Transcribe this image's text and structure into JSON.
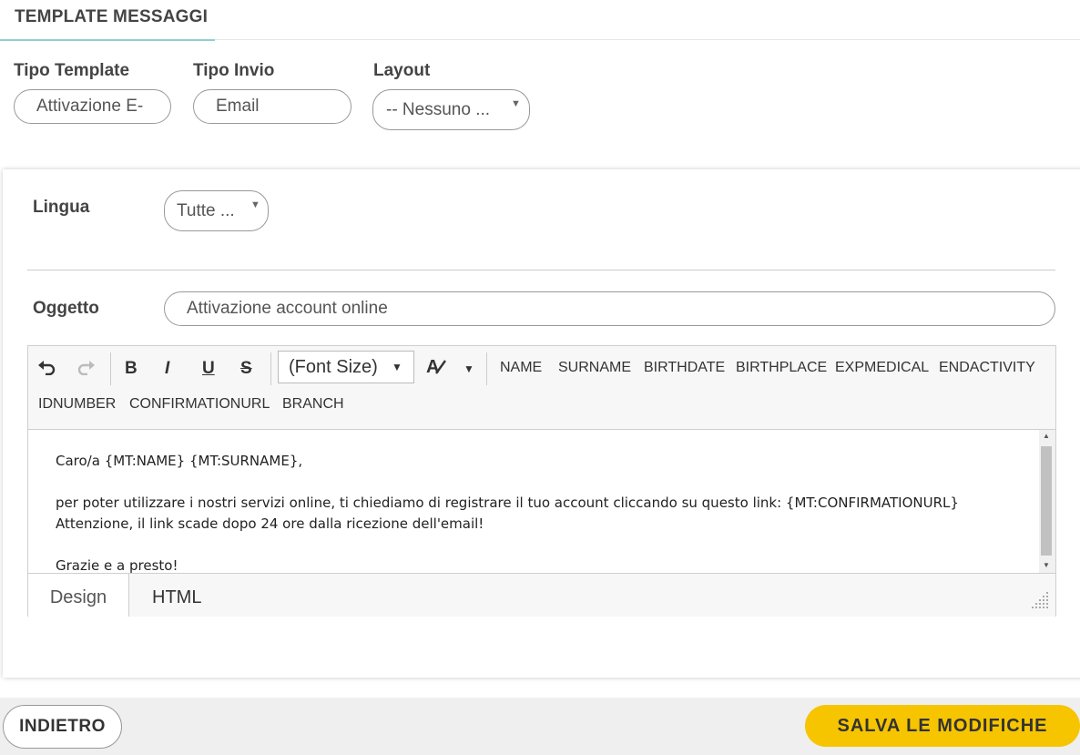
{
  "header": {
    "title": "TEMPLATE MESSAGGI"
  },
  "filters": {
    "tipo_template": {
      "label": "Tipo Template",
      "value": "Attivazione E-"
    },
    "tipo_invio": {
      "label": "Tipo Invio",
      "value": "Email"
    },
    "layout": {
      "label": "Layout",
      "value": "-- Nessuno ..."
    }
  },
  "card": {
    "lingua": {
      "label": "Lingua",
      "value": "Tutte ..."
    },
    "oggetto": {
      "label": "Oggetto",
      "value": "Attivazione account online"
    }
  },
  "editor": {
    "toolbar": {
      "font_size_placeholder": "(Font Size)",
      "bold": "B",
      "italic": "I",
      "underline": "U",
      "strike": "S",
      "tokens": [
        "NAME",
        "SURNAME",
        "BIRTHDATE",
        "BIRTHPLACE",
        "EXPMEDICAL",
        "ENDACTIVITY",
        "IDNUMBER",
        "CONFIRMATIONURL",
        "BRANCH"
      ]
    },
    "content": [
      "Caro/a {MT:NAME} {MT:SURNAME},",
      "per poter utilizzare i nostri servizi online, ti chiediamo di registrare il tuo account cliccando su questo link: {MT:CONFIRMATIONURL}",
      "Attenzione, il link scade dopo 24 ore dalla ricezione dell'email!",
      "Grazie e a presto!"
    ],
    "modes": [
      "Design",
      "HTML"
    ]
  },
  "footer": {
    "back_label": "INDIETRO",
    "save_label": "SALVA LE MODIFICHE"
  },
  "colors": {
    "accent": "#8fd0cf",
    "primary_button": "#f6c500"
  }
}
